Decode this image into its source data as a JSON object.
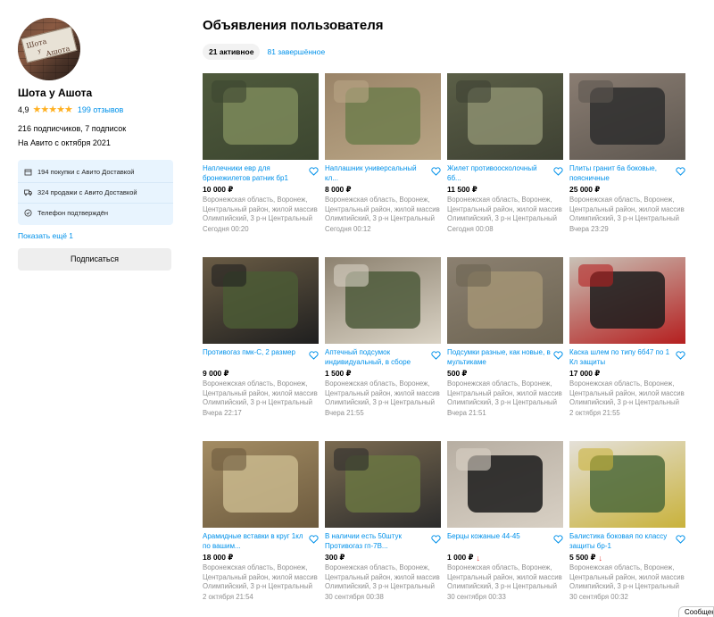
{
  "seller": {
    "avatar_text": "Шота у Ашота",
    "name": "Шота у Ашота",
    "rating": "4,9",
    "stars": "★★★★★",
    "reviews": "199 отзывов",
    "followers": "216 подписчиков, 7 подписок",
    "since": "На Авито с октября 2021",
    "info": [
      {
        "icon": "box-icon",
        "text": "194 покупки с Авито Доставкой"
      },
      {
        "icon": "truck-icon",
        "text": "324 продажи с Авито Доставкой"
      },
      {
        "icon": "check-circle-icon",
        "text": "Телефон подтверждён"
      }
    ],
    "show_more": "Показать ещё 1",
    "subscribe": "Подписаться"
  },
  "main": {
    "title": "Объявления пользователя",
    "tabs": {
      "active": "21 активное",
      "completed": "81 завершённое"
    }
  },
  "listings": [
    {
      "title": "Наплечники евр для бронежилетов ратник бр1",
      "price": "10 000 ₽",
      "price_drop": "",
      "location": "Воронежская область, Воронеж, Центральный район, жилой массив Олимпийский, 3 р-н Центральный",
      "date": "Сегодня 00:20",
      "palette": [
        "#4f5a3c",
        "#7d8a5a",
        "#3c4630"
      ]
    },
    {
      "title": "Наплашник универсальный кл...",
      "price": "8 000 ₽",
      "price_drop": "",
      "location": "Воронежская область, Воронеж, Центральный район, жилой массив Олимпийский, 3 р-н Центральный",
      "date": "Сегодня 00:12",
      "palette": [
        "#9a8468",
        "#6f7d4c",
        "#b9a585"
      ]
    },
    {
      "title": "Жилет противоосколочный 6б...",
      "price": "11 500 ₽",
      "price_drop": "",
      "location": "Воронежская область, Воронеж, Центральный район, жилой массив Олимпийский, 3 р-н Центральный",
      "date": "Сегодня 00:08",
      "palette": [
        "#5b5f47",
        "#8c8f70",
        "#3e4133"
      ]
    },
    {
      "title": "Плиты гранит 6а боковые, поясничные",
      "price": "25 000 ₽",
      "price_drop": "",
      "location": "Воронежская область, Воронеж, Центральный район, жилой массив Олимпийский, 3 р-н Центральный",
      "date": "Вчера 23:29",
      "palette": [
        "#8a7d72",
        "#2e2e2e",
        "#5e5750"
      ]
    },
    {
      "title": "Противогаз пмк-С, 2 размер",
      "price": "9 000 ₽",
      "price_drop": "",
      "location": "Воронежская область, Воронеж, Центральный район, жилой массив Олимпийский, 3 р-н Центральный",
      "date": "Вчера 22:17",
      "palette": [
        "#6a5c45",
        "#4b5a35",
        "#1f1f1f"
      ]
    },
    {
      "title": "Аптечный подсумок индивидуальный, в сборе",
      "price": "1 500 ₽",
      "price_drop": "",
      "location": "Воронежская область, Воронеж, Центральный район, жилой массив Олимпийский, 3 р-н Центральный",
      "date": "Вчера 21:55",
      "palette": [
        "#8d8270",
        "#4e5b3b",
        "#d9d2c4"
      ]
    },
    {
      "title": "Подсумки разные, как новые, в мультикаме",
      "price": "500 ₽",
      "price_drop": "",
      "location": "Воронежская область, Воронеж, Центральный район, жилой массив Олимпийский, 3 р-н Центральный",
      "date": "Вчера 21:51",
      "palette": [
        "#8b8070",
        "#a39474",
        "#6d6452"
      ]
    },
    {
      "title": "Каска шлем по типу 6б47 по 1 Кл защиты",
      "price": "17 000 ₽",
      "price_drop": "",
      "location": "Воронежская область, Воронеж, Центральный район, жилой массив Олимпийский, 3 р-н Центральный",
      "date": "2 октября 21:55",
      "palette": [
        "#c9c1b6",
        "#1c1c1c",
        "#b51f1f"
      ]
    },
    {
      "title": "Арамидные вставки в круг 1кл по вашим...",
      "price": "18 000 ₽",
      "price_drop": "",
      "location": "Воронежская область, Воронеж, Центральный район, жилой массив Олимпийский, 3 р-н Центральный",
      "date": "2 октября 21:54",
      "palette": [
        "#a38c63",
        "#c9b88d",
        "#6c5a3e"
      ]
    },
    {
      "title": "В наличии есть 50штук Противогаз гп-7В...",
      "price": "300 ₽",
      "price_drop": "",
      "location": "Воронежская область, Воронеж, Центральный район, жилой массив Олимпийский, 3 р-н Центральный",
      "date": "30 сентября 00:38",
      "palette": [
        "#7a6a50",
        "#6a7642",
        "#2c2c2c"
      ]
    },
    {
      "title": "Берцы кожаные 44-45",
      "price": "1 000 ₽",
      "price_drop": "↓",
      "location": "Воронежская область, Воронеж, Центральный район, жилой массив Олимпийский, 3 р-н Центральный",
      "date": "30 сентября 00:33",
      "palette": [
        "#b7aea2",
        "#1a1a1a",
        "#d8d0c4"
      ]
    },
    {
      "title": "Балистика боковая по классу защиты бр-1",
      "price": "5 500 ₽",
      "price_drop": "↓",
      "location": "Воронежская область, Воронеж, Центральный район, жилой массив Олимпийский, 3 р-н Центральный",
      "date": "30 сентября 00:32",
      "palette": [
        "#e4e0d8",
        "#4d6a3a",
        "#c9b23b"
      ]
    }
  ],
  "footer": {
    "messages": "Сообщения"
  }
}
